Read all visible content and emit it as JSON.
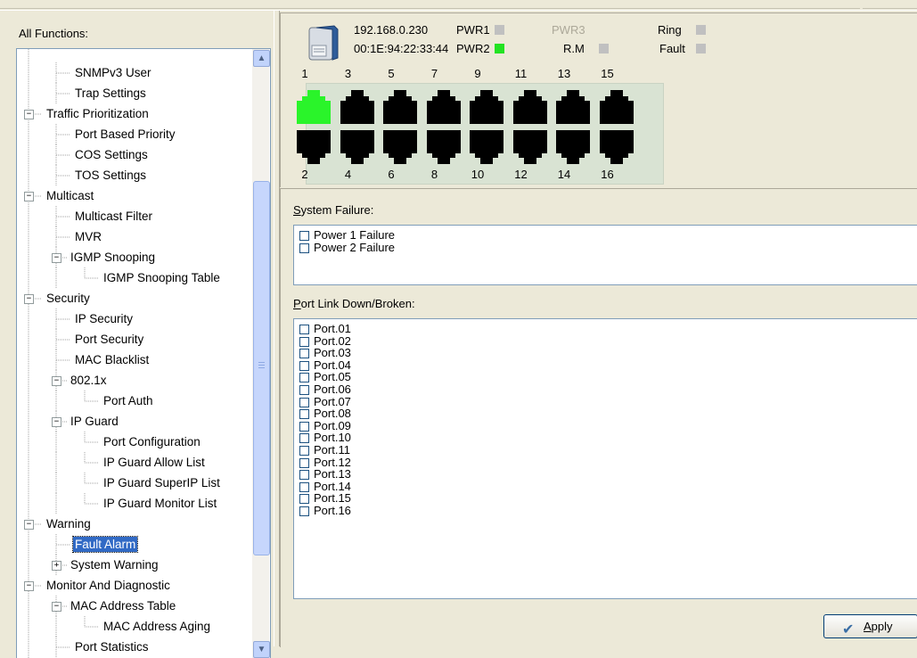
{
  "tree": {
    "title": "All Functions:",
    "items": [
      {
        "label": "SNMPv3 User",
        "level": 2
      },
      {
        "label": "Trap Settings",
        "level": 2
      },
      {
        "label": "Traffic Prioritization",
        "level": 0,
        "expander": "−"
      },
      {
        "label": "Port Based Priority",
        "level": 2
      },
      {
        "label": "COS Settings",
        "level": 2
      },
      {
        "label": "TOS Settings",
        "level": 2
      },
      {
        "label": "Multicast",
        "level": 0,
        "expander": "−"
      },
      {
        "label": "Multicast Filter",
        "level": 2
      },
      {
        "label": "MVR",
        "level": 2
      },
      {
        "label": "IGMP Snooping",
        "level": 1,
        "expander": "−"
      },
      {
        "label": "IGMP Snooping Table",
        "level": 3
      },
      {
        "label": "Security",
        "level": 0,
        "expander": "−"
      },
      {
        "label": "IP Security",
        "level": 2
      },
      {
        "label": "Port Security",
        "level": 2
      },
      {
        "label": "MAC Blacklist",
        "level": 2
      },
      {
        "label": "802.1x",
        "level": 1,
        "expander": "−"
      },
      {
        "label": "Port Auth",
        "level": 3
      },
      {
        "label": "IP Guard",
        "level": 1,
        "expander": "−"
      },
      {
        "label": "Port Configuration",
        "level": 3
      },
      {
        "label": "IP Guard Allow List",
        "level": 3
      },
      {
        "label": "IP Guard SuperIP List",
        "level": 3
      },
      {
        "label": "IP Guard Monitor List",
        "level": 3
      },
      {
        "label": "Warning",
        "level": 0,
        "expander": "−"
      },
      {
        "label": "Fault Alarm",
        "level": 2,
        "selected": true
      },
      {
        "label": "System Warning",
        "level": 1,
        "expander": "+"
      },
      {
        "label": "Monitor And Diagnostic",
        "level": 0,
        "expander": "−"
      },
      {
        "label": "MAC Address Table",
        "level": 1,
        "expander": "−"
      },
      {
        "label": "MAC Address Aging",
        "level": 3
      },
      {
        "label": "Port Statistics",
        "level": 2
      }
    ]
  },
  "device": {
    "ip": "192.168.0.230",
    "mac": "00:1E:94:22:33:44",
    "leds": [
      {
        "label": "PWR1",
        "state": "off",
        "disabled": false
      },
      {
        "label": "PWR3",
        "state": "none",
        "disabled": true
      },
      {
        "label": "Ring",
        "state": "off",
        "disabled": false
      },
      {
        "label": "PWR2",
        "state": "on",
        "disabled": false
      },
      {
        "label": "R.M",
        "state": "off",
        "disabled": false
      },
      {
        "label": "Fault",
        "state": "off",
        "disabled": false
      }
    ],
    "top_ports": [
      "1",
      "3",
      "5",
      "7",
      "9",
      "11",
      "13",
      "15"
    ],
    "bottom_ports": [
      "2",
      "4",
      "6",
      "8",
      "10",
      "12",
      "14",
      "16"
    ],
    "active_ports": [
      "1"
    ],
    "colors": {
      "active": "#2af42a",
      "inactive": "#000000",
      "led_on": "#22e322",
      "led_off": "#c0c0c0"
    }
  },
  "system_failure": {
    "label": "System Failure:",
    "items": [
      "Power 1 Failure",
      "Power 2 Failure"
    ]
  },
  "port_link": {
    "label": "Port Link Down/Broken:",
    "items": [
      "Port.01",
      "Port.02",
      "Port.03",
      "Port.04",
      "Port.05",
      "Port.06",
      "Port.07",
      "Port.08",
      "Port.09",
      "Port.10",
      "Port.11",
      "Port.12",
      "Port.13",
      "Port.14",
      "Port.15",
      "Port.16"
    ]
  },
  "apply_label": "Apply"
}
